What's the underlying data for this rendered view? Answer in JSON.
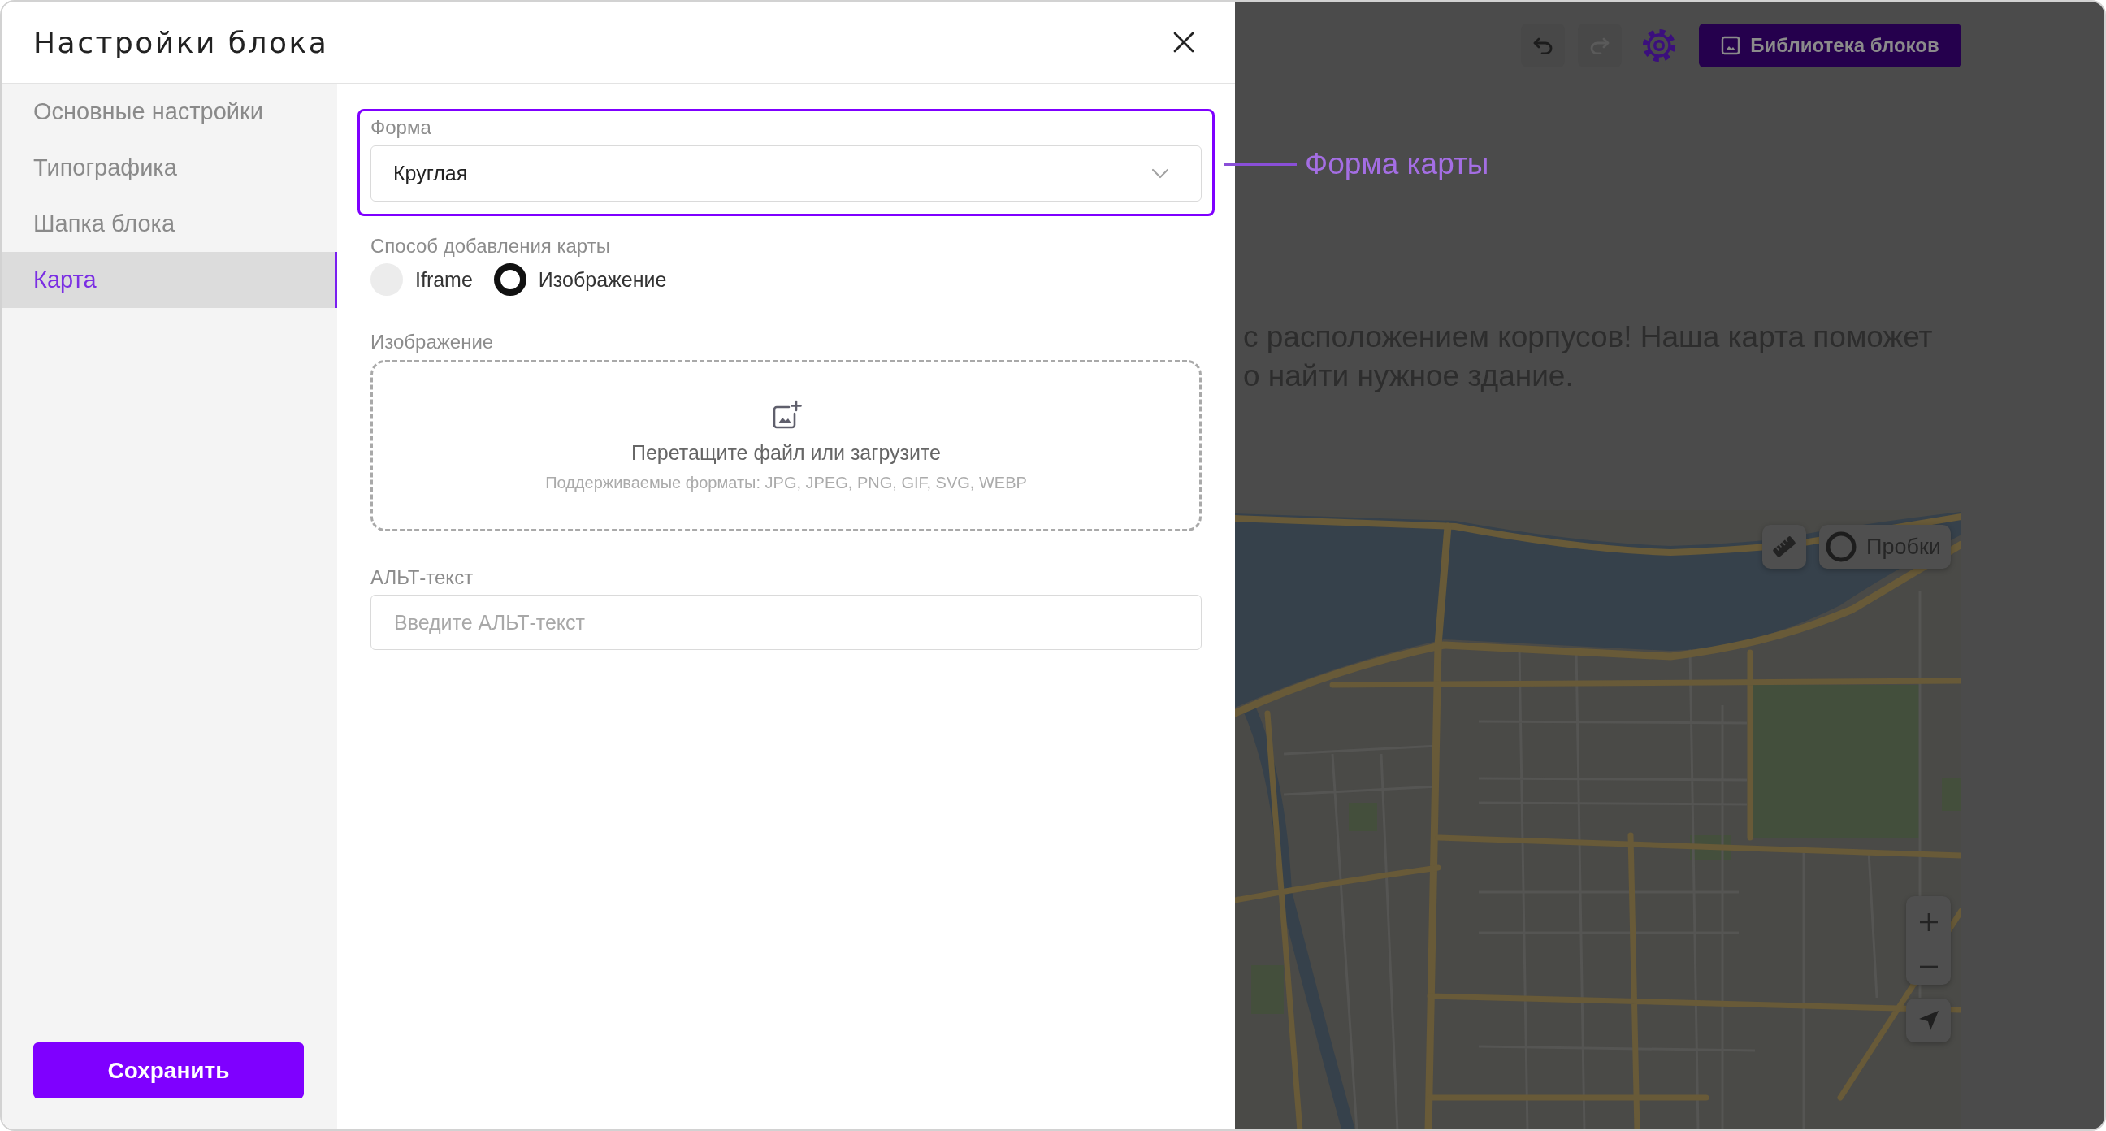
{
  "dialog": {
    "title": "Настройки блока"
  },
  "sidebar": {
    "items": [
      {
        "label": "Основные настройки",
        "selected": false
      },
      {
        "label": "Типографика",
        "selected": false
      },
      {
        "label": "Шапка блока",
        "selected": false
      },
      {
        "label": "Карта",
        "selected": true
      }
    ],
    "save_button": "Сохранить"
  },
  "form": {
    "shape": {
      "label": "Форма",
      "value": "Круглая",
      "highlighted": true
    },
    "add_method": {
      "label": "Способ добавления карты",
      "options": [
        {
          "label": "Iframe",
          "selected": false
        },
        {
          "label": "Изображение",
          "selected": true
        }
      ]
    },
    "image": {
      "label": "Изображение",
      "dropzone_text": "Перетащите файл или загрузите",
      "formats_hint": "Поддерживаемые форматы: JPG, JPEG, PNG, GIF, SVG, WEBP"
    },
    "alt_text": {
      "label": "АЛЬТ-текст",
      "placeholder": "Введите АЛЬТ-текст"
    }
  },
  "annotation": {
    "text": "Форма карты"
  },
  "page_behind": {
    "toolbar": {
      "undo": {
        "disabled": false
      },
      "redo": {
        "disabled": true
      },
      "library_button": "Библиотека блоков"
    },
    "paragraph_lines": [
      "с расположением корпусов! Наша карта поможет",
      "о найти нужное здание."
    ],
    "map": {
      "traffic_button": "Пробки"
    }
  }
}
